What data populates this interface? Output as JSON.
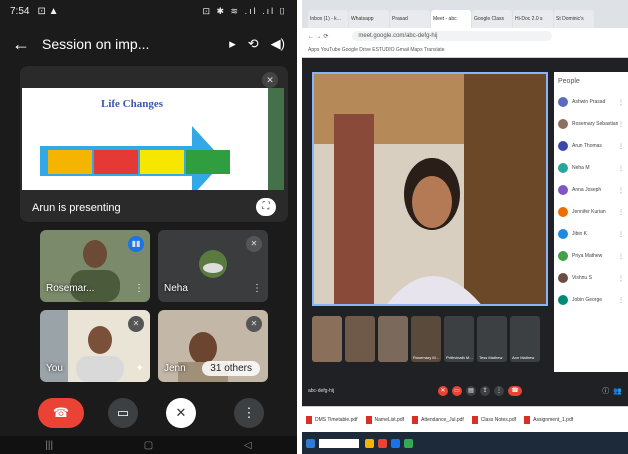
{
  "phone": {
    "status": {
      "time": "7:54",
      "icons_left": "⊡ ▲",
      "icons_right": "⊡ ✱ ≋ .ıl .ıl ⌷"
    },
    "appbar": {
      "title": "Session on imp...",
      "title_suffix_icon": "chevron-right-icon"
    },
    "presentation": {
      "slide_title": "Life Changes",
      "boxes": [
        {
          "label": "",
          "color": "#f4b400"
        },
        {
          "label": "",
          "color": "#e53935"
        },
        {
          "label": "",
          "color": "#f6e600"
        },
        {
          "label": "",
          "color": "#2e9e3e"
        }
      ],
      "arrow_color": "#33a8e6",
      "presenter_label": "Arun is presenting"
    },
    "tiles": [
      {
        "name": "Rosemar...",
        "bg": "#7b8a6a"
      },
      {
        "name": "Neha",
        "bg": "#3b3c3e"
      },
      {
        "name": "You",
        "bg": "#9aa3a8"
      },
      {
        "name": "Jenn",
        "bg": "#c3b7a8"
      }
    ],
    "others_label": "31 others",
    "controls": {
      "end_call_color": "#ea4335"
    }
  },
  "browser": {
    "tabs": [
      "Inbox (1) - k...",
      "Whatsapp",
      "Prasad",
      "Meet - abc",
      "Google Class",
      "Hi-Doc 2.0 s",
      "St Dominic's"
    ],
    "url": "meet.google.com/abc-defg-hij",
    "bookmarks": "Apps   YouTube   Google Drive   ESTUDIO   Gmail   Maps   Translate",
    "meeting_code": "abc-defg-hij",
    "people_header": "People",
    "people": [
      {
        "name": "Ashwin Prasad",
        "color": "#5c6bc0"
      },
      {
        "name": "Rosemary Sebastian",
        "color": "#8d6e63"
      },
      {
        "name": "Arun Thomas",
        "color": "#3949ab"
      },
      {
        "name": "Neha M",
        "color": "#26a69a"
      },
      {
        "name": "Anna Joseph",
        "color": "#7e57c2"
      },
      {
        "name": "Jennifer Kurian",
        "color": "#ef6c00"
      },
      {
        "name": "Jibin K",
        "color": "#1e88e5"
      },
      {
        "name": "Priya Mathew",
        "color": "#43a047"
      },
      {
        "name": "Vishnu S",
        "color": "#6d4c41"
      },
      {
        "name": "Jobin George",
        "color": "#00897b"
      }
    ],
    "strip": [
      {
        "name": "",
        "bg": "#8a6f5a"
      },
      {
        "name": "",
        "bg": "#6f5a4a"
      },
      {
        "name": "",
        "bg": "#7b6a5c"
      },
      {
        "name": "Rosemary M...",
        "bg": "#5a4a3c"
      },
      {
        "name": "Prithvinath M...",
        "bg": "#3c4043"
      },
      {
        "name": "Tess Mathew",
        "bg": "#3c4043"
      },
      {
        "name": "Ann Mathew",
        "bg": "#3c4043"
      }
    ],
    "downloads": [
      "DMS Timetable.pdf",
      "NameList.pdf",
      "Attendance_Jul.pdf",
      "Class Notes.pdf",
      "Assignment_1.pdf"
    ]
  }
}
